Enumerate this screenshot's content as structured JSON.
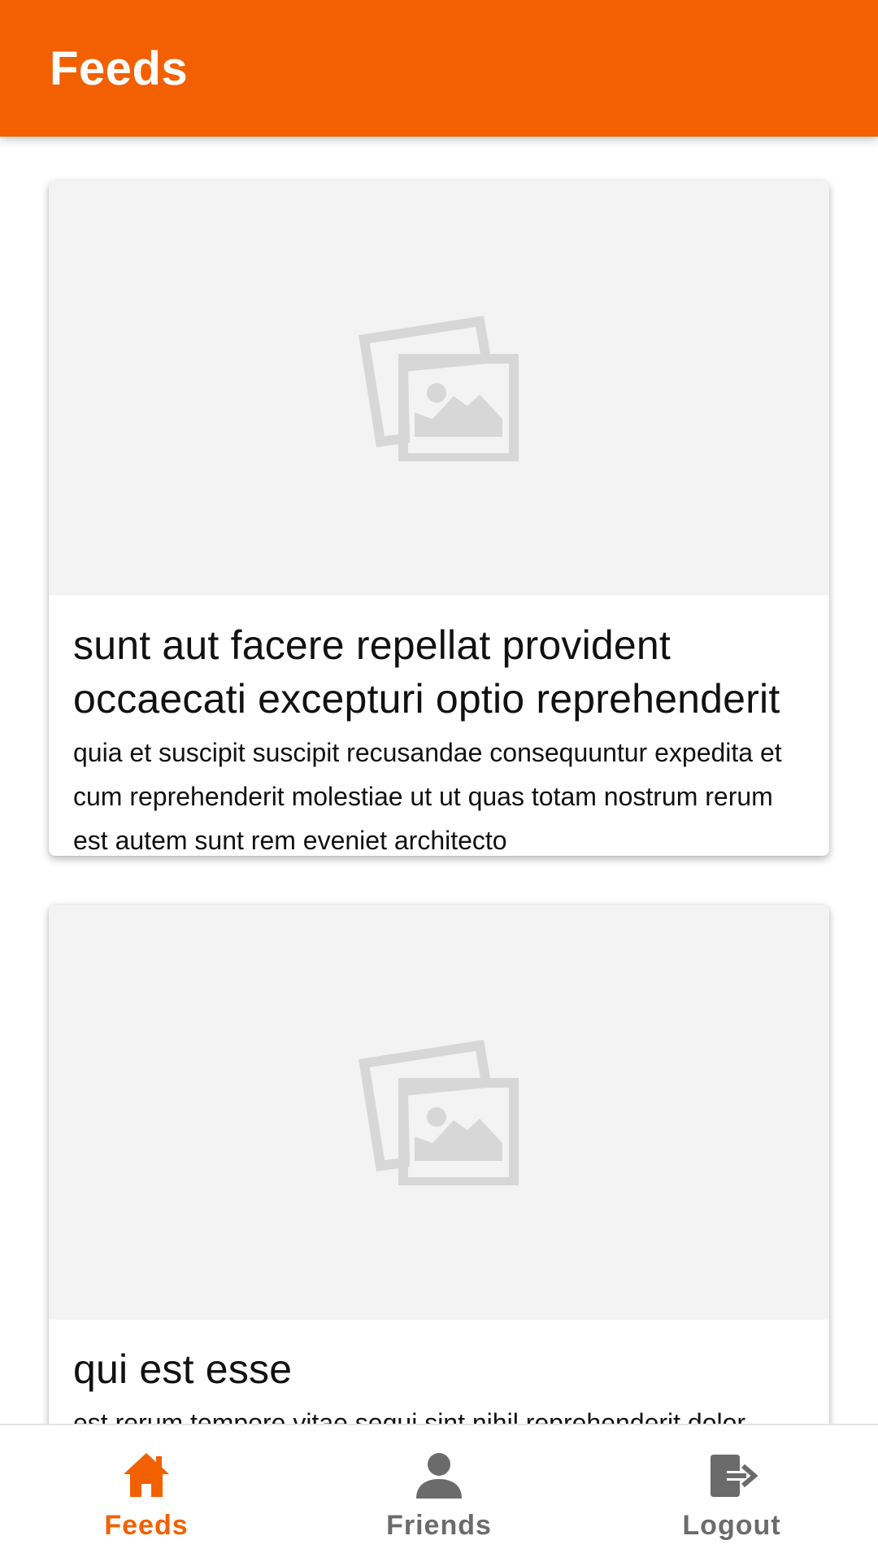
{
  "app": {
    "title": "Feeds",
    "accent_color": "#f26001",
    "inactive_color": "#6b6b6b"
  },
  "feed": {
    "posts": [
      {
        "image_icon": "image-placeholder-icon",
        "title": "sunt aut facere repellat provident occaecati excepturi optio reprehenderit",
        "body": "quia et suscipit suscipit recusandae consequuntur expedita et cum reprehenderit molestiae ut ut quas totam nostrum rerum est autem sunt rem eveniet architecto"
      },
      {
        "image_icon": "image-placeholder-icon",
        "title": "qui est esse",
        "body": "est rerum tempore vitae sequi sint nihil reprehenderit dolor"
      }
    ]
  },
  "bottom_nav": {
    "items": [
      {
        "label": "Feeds",
        "icon": "home-icon",
        "active": true
      },
      {
        "label": "Friends",
        "icon": "person-icon",
        "active": false
      },
      {
        "label": "Logout",
        "icon": "logout-icon",
        "active": false
      }
    ]
  }
}
